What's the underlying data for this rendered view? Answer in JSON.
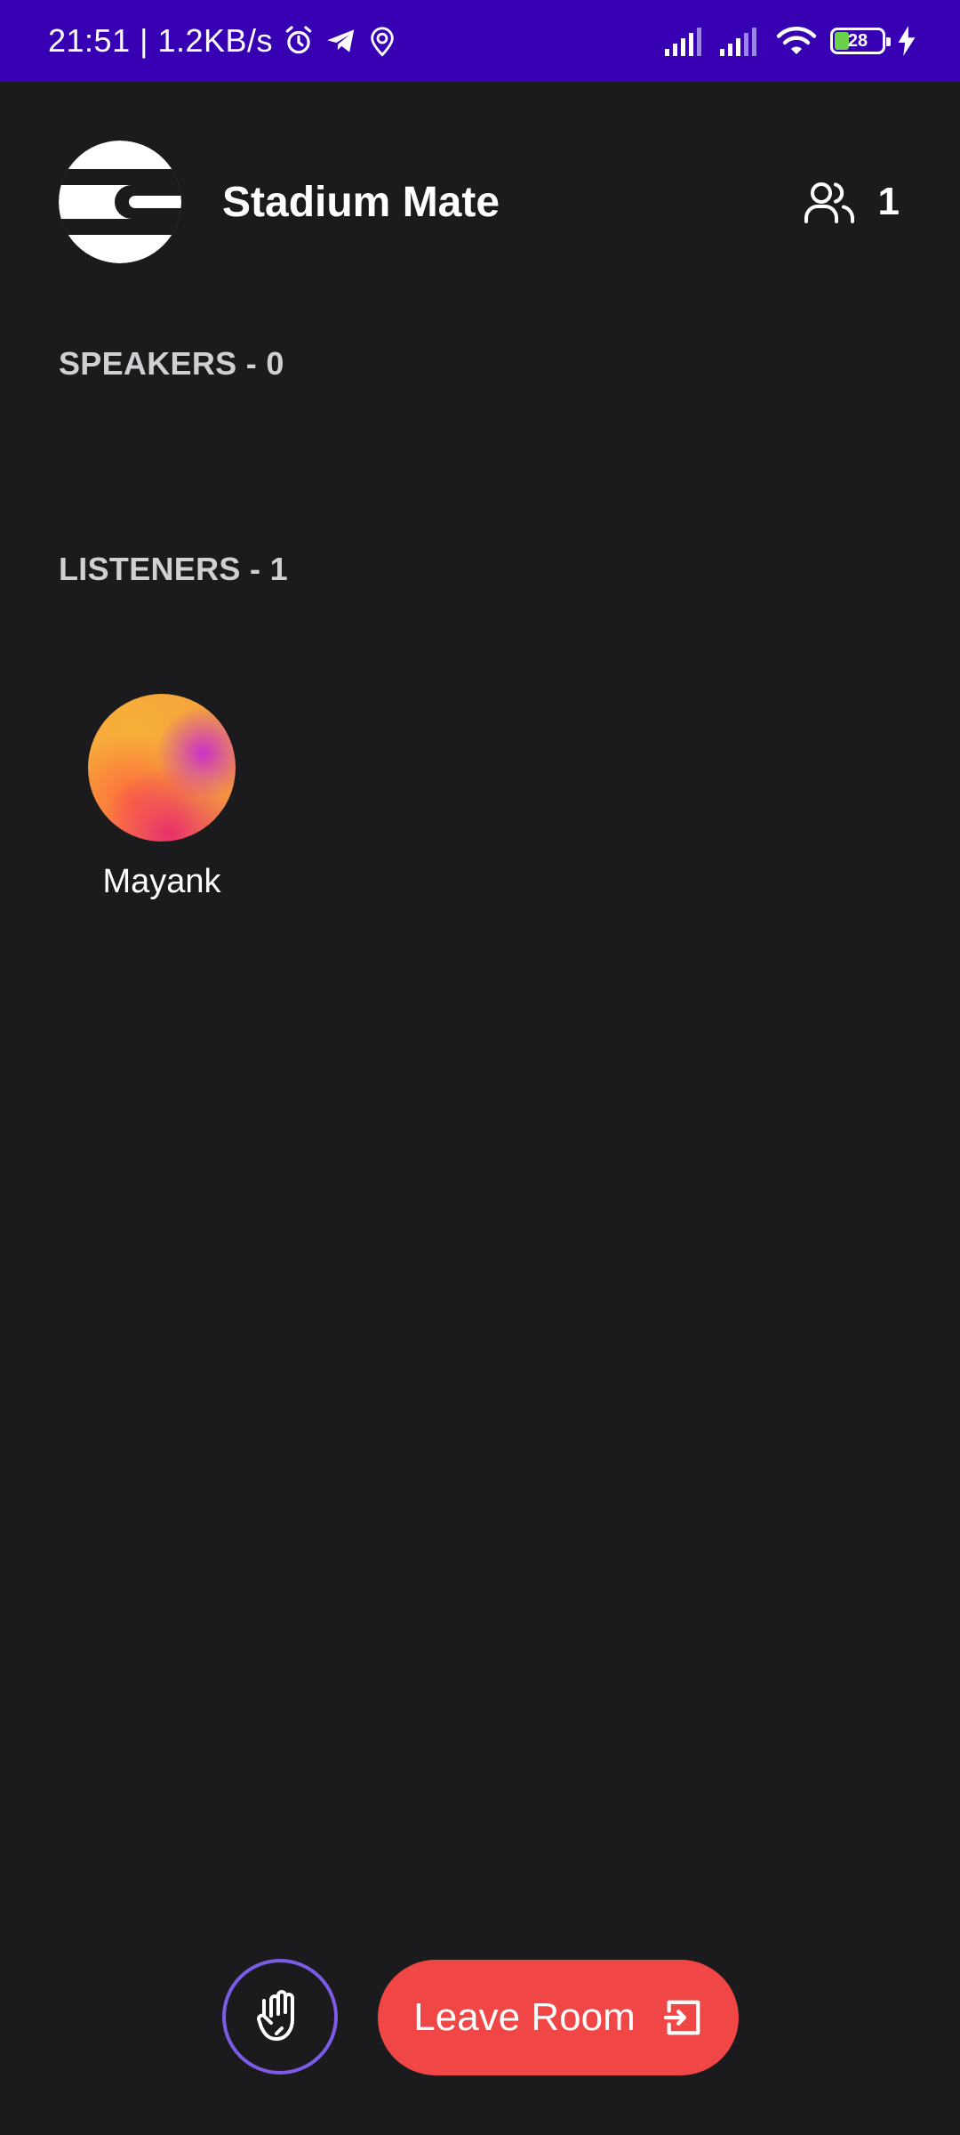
{
  "status_bar": {
    "time_speed": "21:51 | 1.2KB/s",
    "battery_level": "28",
    "icons": [
      "alarm-icon",
      "telegram-icon",
      "location-icon",
      "signal-icon",
      "signal-icon",
      "wifi-icon",
      "battery-icon",
      "charging-icon"
    ]
  },
  "header": {
    "title": "Stadium Mate",
    "listener_count": "1",
    "icons": [
      "room-logo-icon",
      "people-icon"
    ]
  },
  "speakers": {
    "heading": "SPEAKERS - 0",
    "members": []
  },
  "listeners": {
    "heading": "LISTENERS - 1",
    "members": [
      {
        "name": "Mayank"
      }
    ]
  },
  "controls": {
    "leave_label": "Leave Room",
    "icons": [
      "raise-hand-icon",
      "exit-icon"
    ]
  },
  "colors": {
    "status_bar": "#3700b3",
    "background": "#1b1b1d",
    "leave_button": "#f04646",
    "raise_hand_ring": "#7b5ce6",
    "heading_text": "#d0d0d4"
  }
}
